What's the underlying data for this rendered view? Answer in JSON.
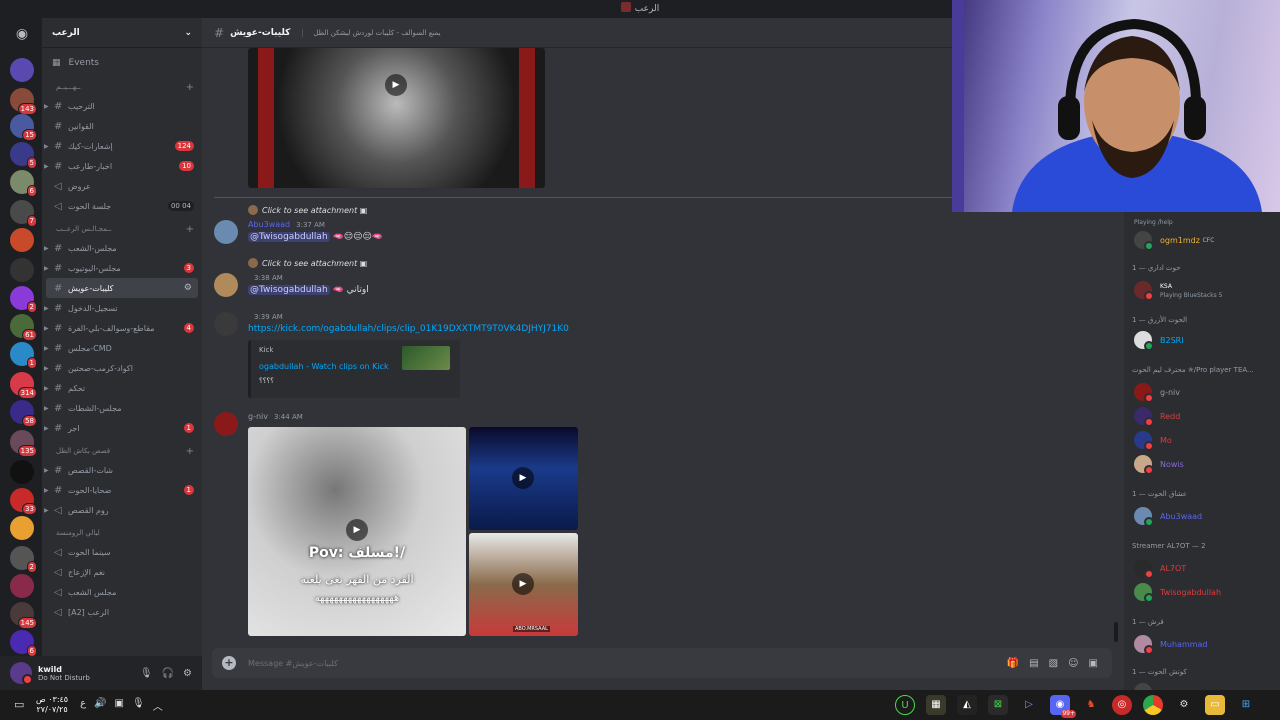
{
  "window": {
    "title": "الرعب"
  },
  "server": {
    "name": "الرعب"
  },
  "sidebar": {
    "events_label": "Events",
    "categories": {
      "cat1": "ــهـــيــم",
      "cat2": "ــمجـالـس الرعــب",
      "cat3": "قصص بكاش الظل",
      "cat4": "ليالي الرومنسة"
    },
    "channels": [
      {
        "name": "الترحيب",
        "badge": ""
      },
      {
        "name": "القوانين",
        "badge": ""
      },
      {
        "name": "إشعارات-كيك",
        "badge": "124"
      },
      {
        "name": "اخبار-طارعب",
        "badge": "10"
      },
      {
        "name": "عروض",
        "badge": ""
      },
      {
        "name": "جلسة الحوت",
        "badge": "00 04"
      },
      {
        "name": "مجلس-الشعب",
        "badge": ""
      },
      {
        "name": "مجلس-اليوتيوب",
        "badge": "3"
      },
      {
        "name": "كليبات-عويش",
        "badge": ""
      },
      {
        "name": "تسجيل-الدخول",
        "badge": ""
      },
      {
        "name": "مقاطع-وسوالف-بلي-الفرة",
        "badge": "4"
      },
      {
        "name": "مجلس-CMD",
        "badge": ""
      },
      {
        "name": "اكواد-كرمب-صحتين",
        "badge": ""
      },
      {
        "name": "تحكم",
        "badge": ""
      },
      {
        "name": "مجلس-الشطات",
        "badge": ""
      },
      {
        "name": "اجر",
        "badge": "1"
      },
      {
        "name": "شات-القصص",
        "badge": ""
      },
      {
        "name": "ضحايا-الحوت",
        "badge": "1"
      },
      {
        "name": "روم القصص",
        "badge": ""
      },
      {
        "name": "سينما الحوت",
        "badge": ""
      },
      {
        "name": "نغم الإزعاج",
        "badge": ""
      },
      {
        "name": "مجلس الشعب",
        "badge": ""
      },
      {
        "name": "[A2] الرعب",
        "badge": ""
      }
    ]
  },
  "user": {
    "name": "kwild",
    "status": "Do Not Disturb"
  },
  "header": {
    "channel": "كليبات-عويش",
    "topic": "يمنع السوالف - كليبات لوردش ليشكن الظل"
  },
  "messages": {
    "m1": {
      "reply": "Click to see attachment",
      "author": "Abu3waad",
      "time": "3:37 AM",
      "mention": "@Twisogabdullah"
    },
    "m2": {
      "reply": "Click to see attachment",
      "author": "",
      "time": "3:38 AM",
      "mention": "@Twisogabdullah",
      "text": "اوتاني"
    },
    "m3": {
      "author": "",
      "time": "3:39 AM",
      "link": "https://kick.com/ogabdullah/clips/clip_01K19DXXTMT9T0VK4DJHYJ71K0"
    },
    "embed": {
      "provider": "Kick",
      "title": "ogabdullah - Watch clips on Kick",
      "desc": "؟؟؟؟"
    },
    "m4": {
      "author": "g-niv",
      "time": "3:44 AM"
    },
    "video_caption": {
      "line1": "Pov: مسلف!/",
      "line2": "القرد من القهر بغى يلعنه",
      "line3": "هههههههههههههههههه"
    },
    "img_watermark": "ABO.MRSAAL"
  },
  "composer": {
    "placeholder": "Message #كليبات-عويش"
  },
  "members": {
    "rows": [
      {
        "name": "Playing /help",
        "color": "#b5bac1"
      },
      {
        "name": "ogm1mdz",
        "tag": "CFC",
        "color": "#f0b232"
      },
      {
        "name": "",
        "tag": "KSA",
        "sub": "Playing BlueStacks 5",
        "color": "#f23f43"
      },
      {
        "name": "B2SRI",
        "color": "#00a8fc"
      },
      {
        "name": "g-niv",
        "color": "#949ba4"
      },
      {
        "name": "Redd",
        "color": "#e03a3a"
      },
      {
        "name": "Mo",
        "color": "#e03a3a"
      },
      {
        "name": "Nowis",
        "color": "#8a6ad8"
      },
      {
        "name": "Abu3waad",
        "color": "#5865f2"
      },
      {
        "name": "AL7OT",
        "color": "#e03a3a"
      },
      {
        "name": "Twisogabdullah",
        "color": "#e03a3a"
      },
      {
        "name": "Muhammad",
        "color": "#5865f2"
      },
      {
        "name": "",
        "color": "#5865f2"
      }
    ],
    "cats": [
      {
        "label": "حوت اداري — 1"
      },
      {
        "label": "الحوت الأزرق — 1"
      },
      {
        "label": "محترف ليم الحوت ✯/Pro player TEA..."
      },
      {
        "label": "عشاق الحوت — 1"
      },
      {
        "label": "Streamer AL7OT — 2"
      },
      {
        "label": "قرش — 1"
      },
      {
        "label": "كوتش الحوت — 1"
      }
    ]
  },
  "taskbar": {
    "time": "٠٣:٤٥ ص",
    "date": "٢٧/٠٧/٢٥",
    "lang": "ع",
    "discord_badge": "99+"
  }
}
